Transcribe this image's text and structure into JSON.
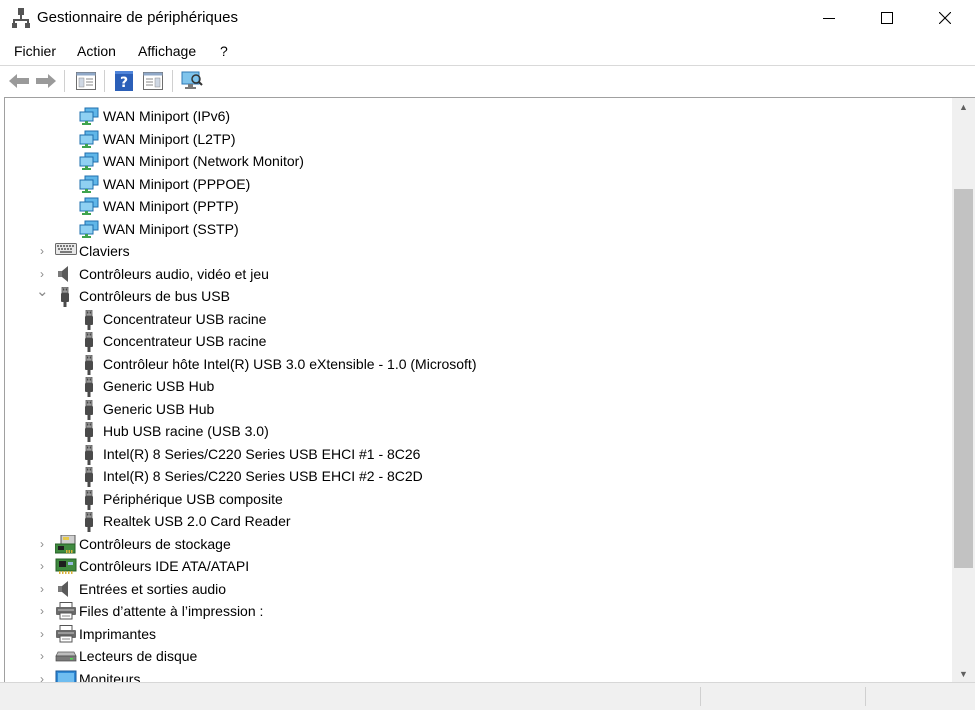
{
  "window": {
    "title": "Gestionnaire de périphériques",
    "controls": [
      "minimize-icon",
      "maximize-icon",
      "close-icon"
    ]
  },
  "menu": [
    "Fichier",
    "Action",
    "Affichage",
    "?"
  ],
  "toolbar": [
    "back-arrow-icon",
    "forward-arrow-icon",
    "properties-icon",
    "help-icon",
    "view-icon",
    "scan-hardware-icon"
  ],
  "tree": [
    {
      "label": "WAN Miniport (IPv6)",
      "level": 2,
      "icon": "network-adapter-icon"
    },
    {
      "label": "WAN Miniport (L2TP)",
      "level": 2,
      "icon": "network-adapter-icon"
    },
    {
      "label": "WAN Miniport (Network Monitor)",
      "level": 2,
      "icon": "network-adapter-icon"
    },
    {
      "label": "WAN Miniport (PPPOE)",
      "level": 2,
      "icon": "network-adapter-icon"
    },
    {
      "label": "WAN Miniport (PPTP)",
      "level": 2,
      "icon": "network-adapter-icon"
    },
    {
      "label": "WAN Miniport (SSTP)",
      "level": 2,
      "icon": "network-adapter-icon"
    },
    {
      "label": "Claviers",
      "level": 1,
      "icon": "keyboard-icon",
      "state": "collapsed"
    },
    {
      "label": "Contrôleurs audio, vidéo et jeu",
      "level": 1,
      "icon": "speaker-icon",
      "state": "collapsed"
    },
    {
      "label": "Contrôleurs de bus USB",
      "level": 1,
      "icon": "usb-icon",
      "state": "expanded"
    },
    {
      "label": "Concentrateur USB racine",
      "level": 2,
      "icon": "usb-icon"
    },
    {
      "label": "Concentrateur USB racine",
      "level": 2,
      "icon": "usb-icon"
    },
    {
      "label": "Contrôleur hôte Intel(R) USB 3.0 eXtensible - 1.0 (Microsoft)",
      "level": 2,
      "icon": "usb-icon"
    },
    {
      "label": "Generic USB Hub",
      "level": 2,
      "icon": "usb-icon"
    },
    {
      "label": "Generic USB Hub",
      "level": 2,
      "icon": "usb-icon"
    },
    {
      "label": "Hub USB racine (USB 3.0)",
      "level": 2,
      "icon": "usb-icon"
    },
    {
      "label": "Intel(R) 8 Series/C220 Series USB EHCI #1 - 8C26",
      "level": 2,
      "icon": "usb-icon"
    },
    {
      "label": "Intel(R) 8 Series/C220 Series USB EHCI #2 - 8C2D",
      "level": 2,
      "icon": "usb-icon"
    },
    {
      "label": "Périphérique USB composite",
      "level": 2,
      "icon": "usb-icon"
    },
    {
      "label": "Realtek USB 2.0 Card Reader",
      "level": 2,
      "icon": "usb-icon"
    },
    {
      "label": "Contrôleurs de stockage",
      "level": 1,
      "icon": "storage-controller-icon",
      "state": "collapsed"
    },
    {
      "label": "Contrôleurs IDE ATA/ATAPI",
      "level": 1,
      "icon": "ide-controller-icon",
      "state": "collapsed"
    },
    {
      "label": "Entrées et sorties audio",
      "level": 1,
      "icon": "speaker-icon",
      "state": "collapsed"
    },
    {
      "label": "Files d’attente à l’impression :",
      "level": 1,
      "icon": "printer-icon",
      "state": "collapsed"
    },
    {
      "label": "Imprimantes",
      "level": 1,
      "icon": "printer-icon",
      "state": "collapsed"
    },
    {
      "label": "Lecteurs de disque",
      "level": 1,
      "icon": "disk-drive-icon",
      "state": "collapsed"
    },
    {
      "label": "Moniteurs",
      "level": 1,
      "icon": "monitor-icon",
      "state": "collapsed"
    }
  ],
  "scrollbar": {
    "position": 0.43,
    "visible_fraction": 0.69
  }
}
